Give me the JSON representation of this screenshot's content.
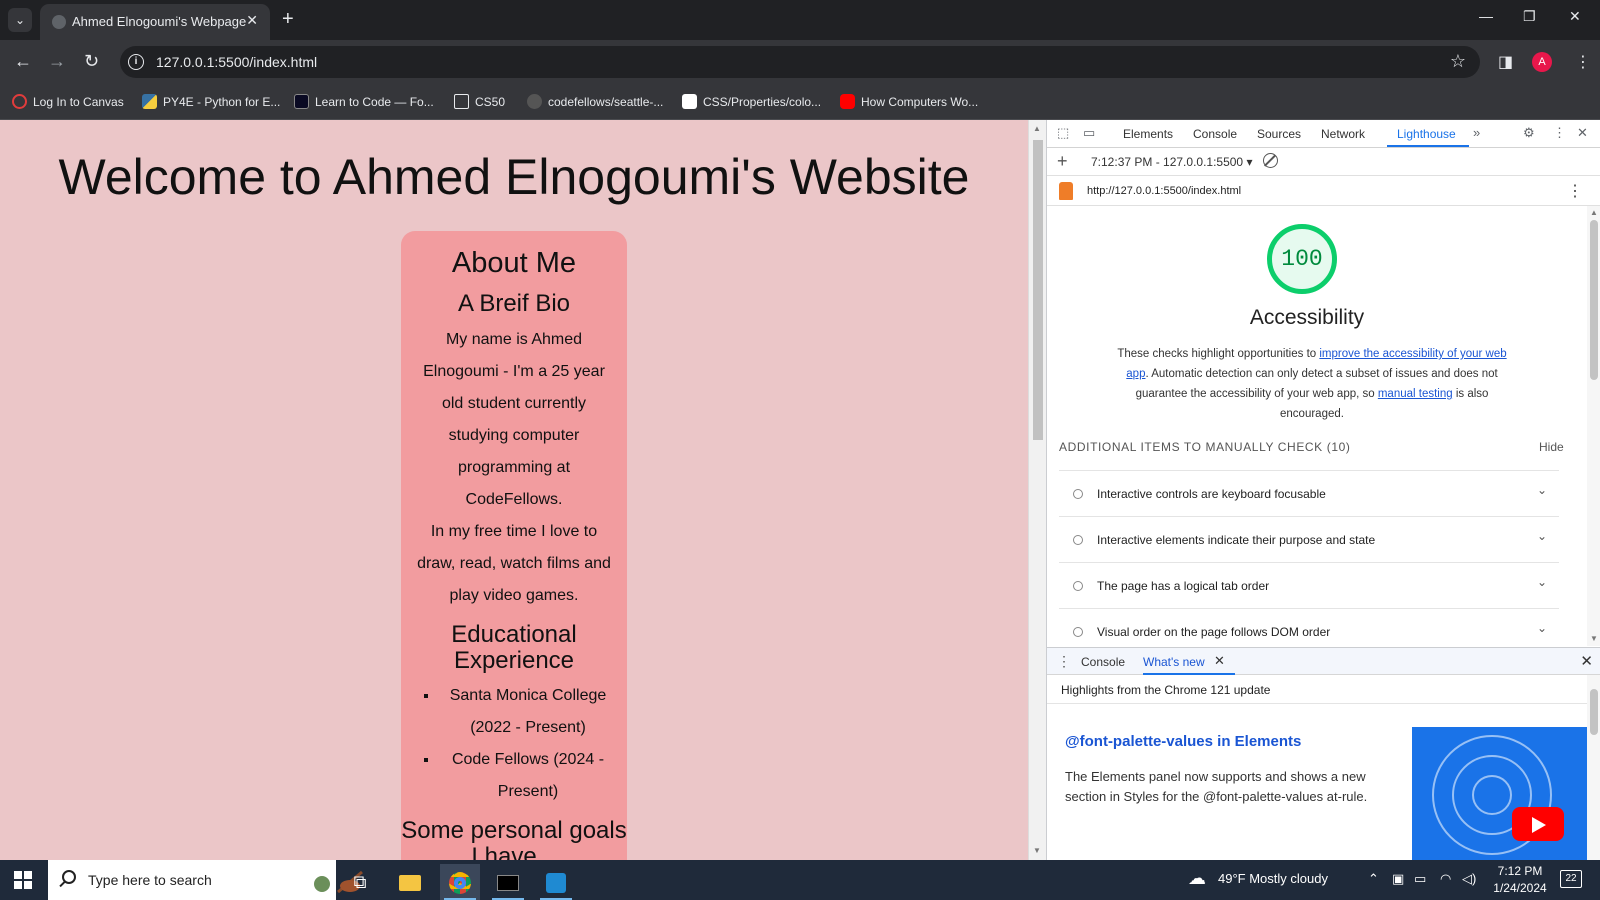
{
  "browser": {
    "tab_title": "Ahmed Elnogoumi's Webpage",
    "url": "127.0.0.1:5500/index.html",
    "avatar_letter": "A",
    "bookmarks": [
      {
        "label": "Log In to Canvas",
        "icon": "canvas-icon",
        "color": "#e13c3c"
      },
      {
        "label": "PY4E - Python for E...",
        "icon": "python-icon",
        "color": "#3772a4"
      },
      {
        "label": "Learn to Code — Fo...",
        "icon": "freecodecamp-icon",
        "color": "#0a0a23"
      },
      {
        "label": "CS50",
        "icon": "folder-icon",
        "color": "#35363a"
      },
      {
        "label": "codefellows/seattle-...",
        "icon": "github-icon",
        "color": "#555555"
      },
      {
        "label": "CSS/Properties/colo...",
        "icon": "w3schools-icon",
        "color": "#ffffff"
      },
      {
        "label": "How Computers Wo...",
        "icon": "youtube-icon",
        "color": "#ff0000"
      }
    ]
  },
  "page": {
    "heading": "Welcome to Ahmed Elnogoumi's Website",
    "about_title": "About Me",
    "bio_title": "A Breif Bio",
    "bio_p1": "My name is Ahmed Elnogoumi - I'm a 25 year old student currently studying computer programming at CodeFellows.",
    "bio_p2": "In my free time I love to draw, read, watch films and play video games.",
    "edu_title": "Educational Experience",
    "edu_items": [
      "Santa Monica College (2022 - Present)",
      "Code Fellows (2024 - Present)"
    ],
    "goals_title": "Some personal goals I have...",
    "colors": {
      "background": "#ebc6c8",
      "card": "#f29c9f"
    }
  },
  "devtools": {
    "tabs": [
      "Elements",
      "Console",
      "Sources",
      "Network",
      "Lighthouse"
    ],
    "active_tab": "Lighthouse",
    "report_selector": "7:12:37 PM - 127.0.0.1:5500",
    "report_url": "http://127.0.0.1:5500/index.html",
    "score": "100",
    "score_value": 100,
    "category": "Accessibility",
    "desc_pre": "These checks highlight opportunities to ",
    "desc_link1": "improve the accessibility of your web app",
    "desc_mid": ". Automatic detection can only detect a subset of issues and does not guarantee the accessibility of your web app, so ",
    "desc_link2": "manual testing",
    "desc_post": " is also encouraged.",
    "manual_header": "ADDITIONAL ITEMS TO MANUALLY CHECK (10)",
    "hide_label": "Hide",
    "audits": [
      "Interactive controls are keyboard focusable",
      "Interactive elements indicate their purpose and state",
      "The page has a logical tab order",
      "Visual order on the page follows DOM order"
    ],
    "drawer_tabs": [
      "Console",
      "What's new"
    ],
    "drawer_active": "What's new",
    "whatsnew_highlight": "Highlights from the Chrome 121 update",
    "whatsnew_title": "@font-palette-values in Elements",
    "whatsnew_body": "The Elements panel now supports and shows a new section in Styles for the @font-palette-values at-rule."
  },
  "taskbar": {
    "search_placeholder": "Type here to search",
    "weather": "49°F  Mostly cloudy",
    "time": "7:12 PM",
    "date": "1/24/2024",
    "notifications": "22"
  }
}
